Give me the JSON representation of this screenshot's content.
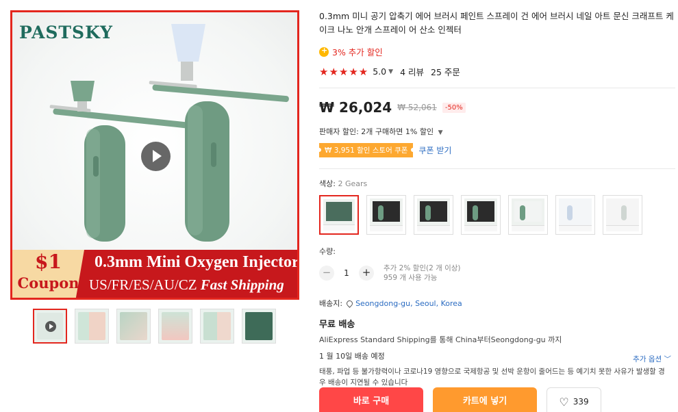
{
  "gallery": {
    "logo": "PASTSKY",
    "banner": {
      "coupon_amount": "$1",
      "coupon_label": "Coupon",
      "headline": "0.3mm Mini Oxygen Injector",
      "countries": "US/FR/ES/AU/CZ",
      "shipping": "Fast Shipping"
    }
  },
  "product": {
    "title": "0.3mm 미니 공기 압축기 에어 브러시 페인트 스프레이 건 에어 브러시 네일 아트 문신 크래프트 케이크 나노 안개 스프레이 어 산소 인젝터",
    "extra_discount": "3% 추가 할인",
    "rating": "5.0",
    "reviews": "4 리뷰",
    "orders": "25 주문",
    "price": "₩ 26,024",
    "old_price": "₩ 52,061",
    "discount_pct": "-50%",
    "seller_discount": "판매자 할인: 2개 구매하면 1% 할인",
    "store_coupon": "₩ 3,951 할인 스토어 쿠폰",
    "get_coupon": "쿠폰 받기",
    "color_label": "색상:",
    "color_value": "2 Gears",
    "quantity_label": "수량:",
    "quantity": "1",
    "qty_note_1": "추가 2% 할인(2 개 이상)",
    "qty_note_2": "959 개 사용 가능",
    "ship_to_label": "배송지:",
    "ship_to_location": "Seongdong-gu, Seoul, Korea",
    "free_shipping": "무료 배송",
    "shipping_desc": "AliExpress Standard Shipping를 통해 China부터Seongdong-gu 까지",
    "delivery_date": "1 월 10일 배송 예정",
    "notice": "태풍, 파업 등 불가항력이나 코로나19 영향으로 국제항공 및 선박 운항이 줄어드는 등 예기치 못한 사유가 발생할 경우 배송이 지연될 수 있습니다",
    "more_options": "추가 옵션",
    "buy_now": "바로 구매",
    "add_to_cart": "카트에 넣기",
    "wishlist_count": "339"
  },
  "colors": {
    "accent_red": "#e3261e",
    "buy_red": "#ff4747",
    "cart_orange": "#ff9a2e",
    "link_blue": "#2a6bc1"
  }
}
